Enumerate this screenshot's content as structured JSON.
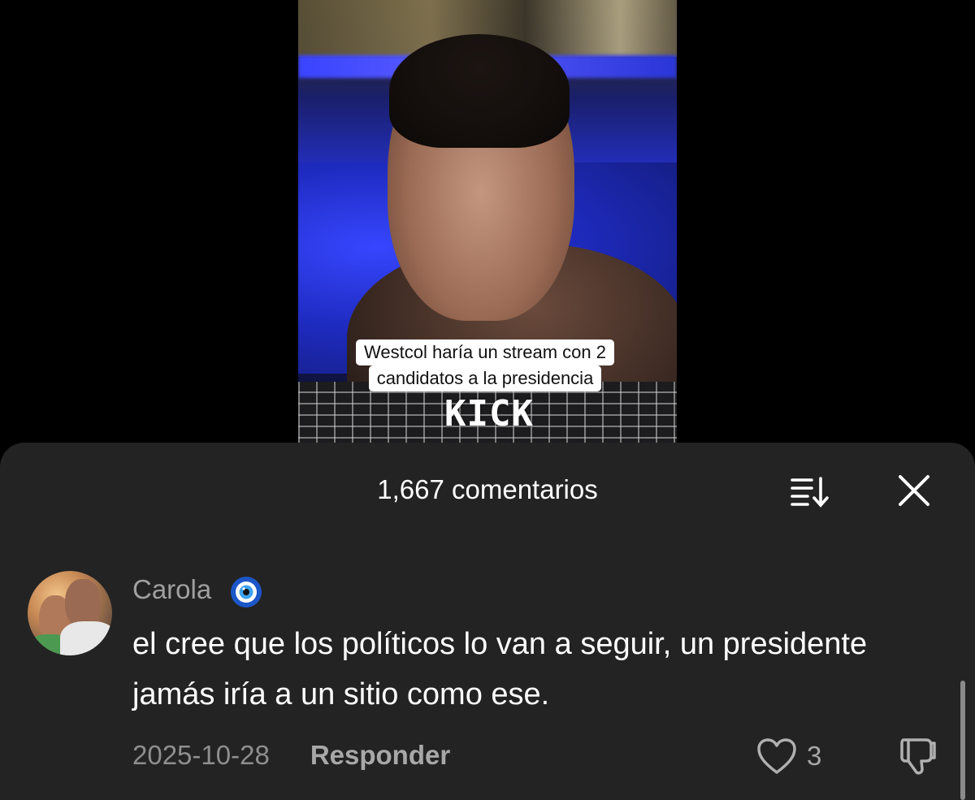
{
  "video": {
    "caption_line1": "Westcol haría un stream con 2",
    "caption_line2": "candidatos a la presidencia",
    "watermark": "KICK"
  },
  "comments_panel": {
    "title": "1,667 comentarios",
    "sort_icon": "sort-icon",
    "close_icon": "close-icon"
  },
  "comment": {
    "username": "Carola",
    "badge_icon": "nazar-amulet-icon",
    "text": "el cree que los políticos lo van a seguir, un presidente jamás iría a un sitio como ese.",
    "date": "2025-10-28",
    "reply_label": "Responder",
    "like_count": "3",
    "like_icon": "heart-outline-icon",
    "dislike_icon": "thumbs-down-icon"
  },
  "colors": {
    "panel_bg": "#232323",
    "text_primary": "#ffffff",
    "text_secondary": "#a0a0a0",
    "date_color": "#8e8e8e"
  }
}
